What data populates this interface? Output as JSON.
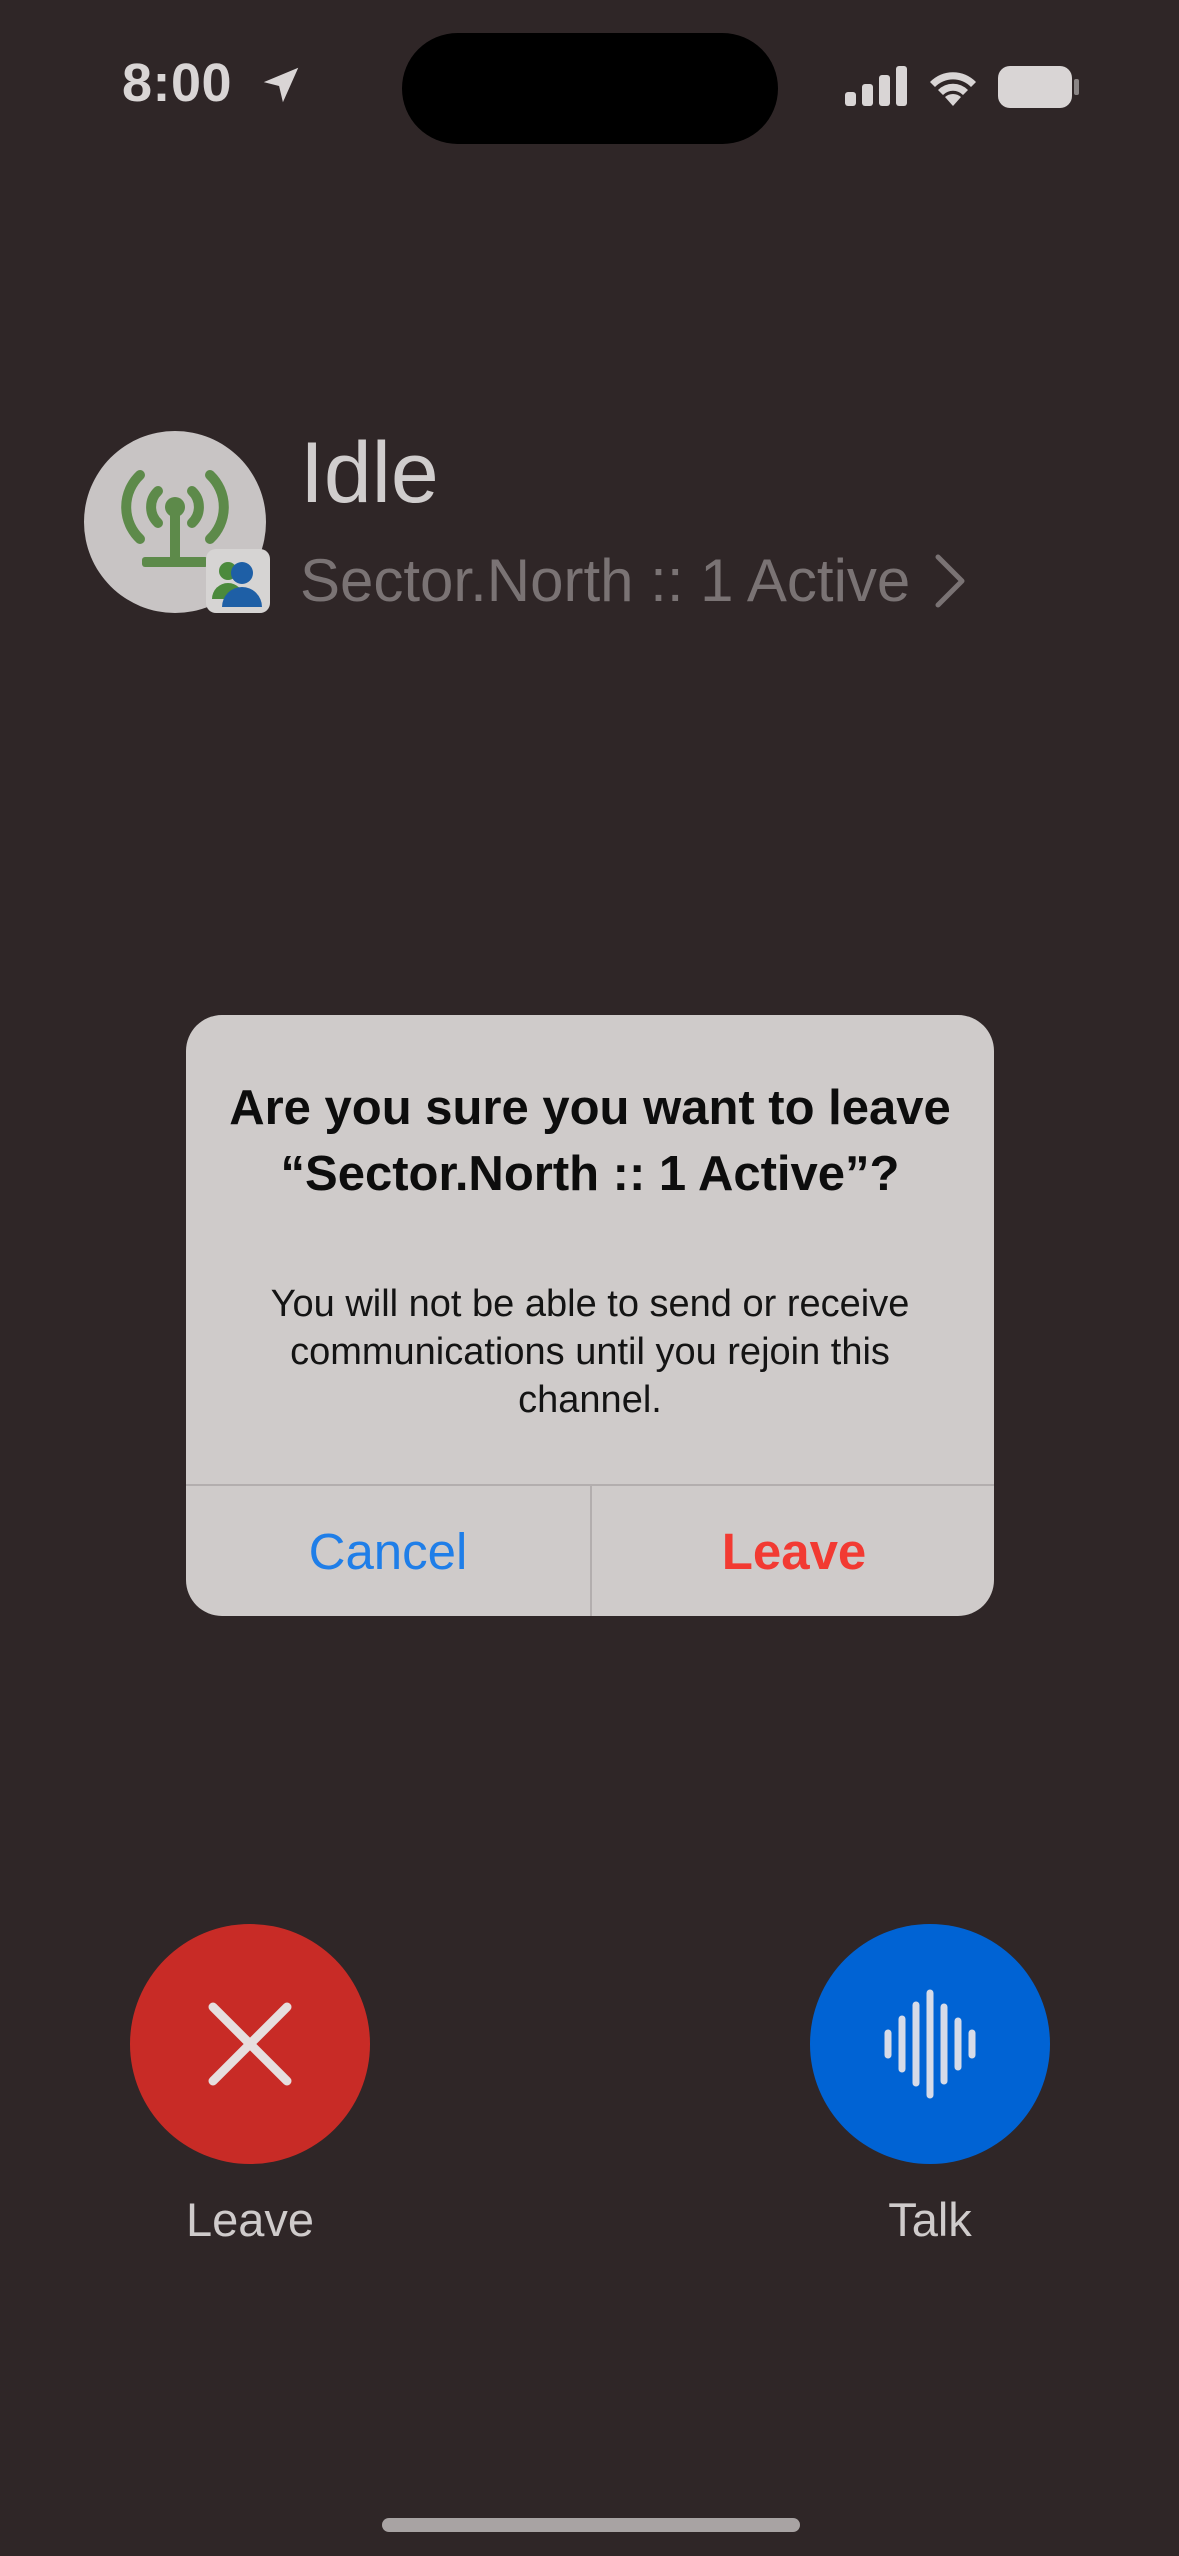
{
  "status_bar": {
    "time": "8:00"
  },
  "channel": {
    "status": "Idle",
    "subtitle": "Sector.North :: 1 Active"
  },
  "alert": {
    "title": "Are you sure you want to leave “Sector.North :: 1 Active”?",
    "message": "You will not be able to send or receive communications until you rejoin this channel.",
    "cancel_label": "Cancel",
    "leave_label": "Leave"
  },
  "controls": {
    "leave_label": "Leave",
    "talk_label": "Talk"
  },
  "icons": {
    "location": "location-arrow-icon",
    "signal": "cellular-signal-icon",
    "wifi": "wifi-icon",
    "battery": "battery-icon",
    "antenna": "radio-antenna-icon",
    "user_badge": "user-group-icon",
    "chevron": "chevron-right-icon",
    "close": "close-icon",
    "waveform": "waveform-icon"
  },
  "colors": {
    "background": "#2f2627",
    "leave_button": "#c82b26",
    "talk_button": "#0063d4",
    "alert_cancel": "#1f7ee8",
    "alert_leave": "#f23a32",
    "antenna_green": "#5d8a4a"
  }
}
